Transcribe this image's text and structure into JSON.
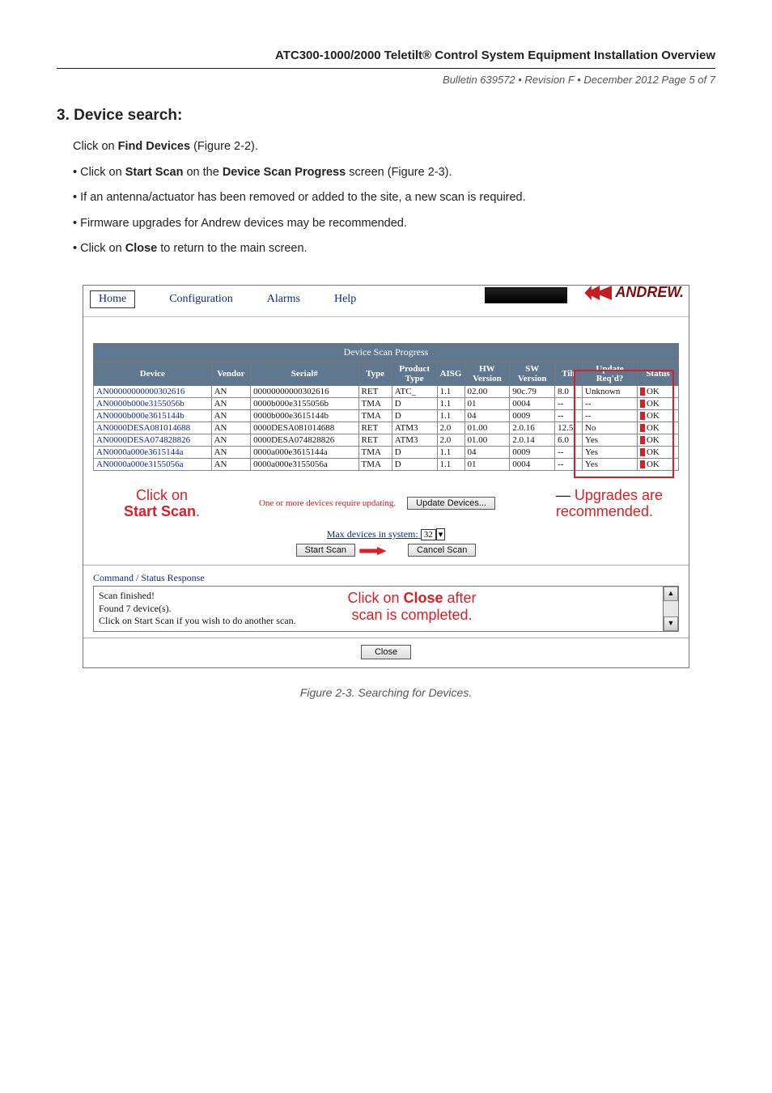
{
  "header": {
    "title": "ATC300-1000/2000 Teletilt® Control System Equipment Installation Overview",
    "meta": "Bulletin 639572 • Revision F • December 2012 Page 5 of 7"
  },
  "section": {
    "heading": "3. Device search:",
    "intro_pre": "Click on ",
    "intro_bold": "Find Devices",
    "intro_post": " (Figure 2-2).",
    "bullets": {
      "b1_pre": "• Click on ",
      "b1_bold1": "Start Scan",
      "b1_mid": " on the ",
      "b1_bold2": "Device Scan Progress",
      "b1_post": " screen (Figure 2-3).",
      "b2": "• If an antenna/actuator has been removed or added to the site, a new scan is required.",
      "b3": "• Firmware upgrades for Andrew devices may be recommended.",
      "b4_pre": "• Click on ",
      "b4_bold": "Close",
      "b4_post": " to return to the main screen."
    }
  },
  "figure": {
    "caption": "Figure 2-3. Searching for Devices.",
    "menu": {
      "home": "Home",
      "config": "Configuration",
      "alarms": "Alarms",
      "help": "Help"
    },
    "brand": "ANDREW.",
    "table_title": "Device Scan Progress",
    "columns": {
      "device": "Device",
      "vendor": "Vendor",
      "serial": "Serial#",
      "type": "Type",
      "ptype": "Product Type",
      "aisc": "AISG",
      "hw": "HW Version",
      "sw": "SW Version",
      "tilt": "Tilt",
      "upd": "Update Req'd?",
      "status": "Status"
    },
    "rows": [
      {
        "device": "AN00000000000302616",
        "vendor": "AN",
        "serial": "00000000000302616",
        "type": "RET",
        "ptype": "ATC_",
        "aisc": "1.1",
        "hw": "02.00",
        "sw": "90c.79",
        "tilt": "8.0",
        "upd": "Unknown",
        "status": "OK"
      },
      {
        "device": "AN0000b000e3155056b",
        "vendor": "AN",
        "serial": "0000b000e3155056b",
        "type": "TMA",
        "ptype": "D",
        "aisc": "1.1",
        "hw": "01",
        "sw": "0004",
        "tilt": "--",
        "upd": "--",
        "status": "OK"
      },
      {
        "device": "AN0000b000e3615144b",
        "vendor": "AN",
        "serial": "0000b000e3615144b",
        "type": "TMA",
        "ptype": "D",
        "aisc": "1.1",
        "hw": "04",
        "sw": "0009",
        "tilt": "--",
        "upd": "--",
        "status": "OK"
      },
      {
        "device": "AN0000DESA081014688",
        "vendor": "AN",
        "serial": "0000DESA081014688",
        "type": "RET",
        "ptype": "ATM3",
        "aisc": "2.0",
        "hw": "01.00",
        "sw": "2.0.16",
        "tilt": "12.5",
        "upd": "No",
        "status": "OK"
      },
      {
        "device": "AN0000DESA074828826",
        "vendor": "AN",
        "serial": "0000DESA074828826",
        "type": "RET",
        "ptype": "ATM3",
        "aisc": "2.0",
        "hw": "01.00",
        "sw": "2.0.14",
        "tilt": "6.0",
        "upd": "Yes",
        "status": "OK"
      },
      {
        "device": "AN0000a000e3615144a",
        "vendor": "AN",
        "serial": "0000a000e3615144a",
        "type": "TMA",
        "ptype": "D",
        "aisc": "1.1",
        "hw": "04",
        "sw": "0009",
        "tilt": "--",
        "upd": "Yes",
        "status": "OK"
      },
      {
        "device": "AN0000a000e3155056a",
        "vendor": "AN",
        "serial": "0000a000e3155056a",
        "type": "TMA",
        "ptype": "D",
        "aisc": "1.1",
        "hw": "01",
        "sw": "0004",
        "tilt": "--",
        "upd": "Yes",
        "status": "OK"
      }
    ],
    "update_msg": "One or more devices require updating.",
    "update_btn": "Update Devices...",
    "max_devices_label": "Max devices in system:",
    "max_devices_value": "32",
    "start_scan_btn": "Start Scan",
    "cancel_scan_btn": "Cancel Scan",
    "cmd_title": "Command / Status Response",
    "cmd_lines": {
      "l1": "Scan finished!",
      "l2": "Found 7 device(s).",
      "l3": "Click on Start Scan if you wish to do another scan."
    },
    "close_btn": "Close",
    "annot": {
      "click_start_l1": "Click on",
      "click_start_l2": "Start Scan",
      "click_start_dot": ".",
      "upgrades_l1": "Upgrades are",
      "upgrades_l2": "recommended.",
      "close_l1_pre": "Click on ",
      "close_l1_bold": "Close",
      "close_l1_post": " after",
      "close_l2": "scan is completed."
    }
  }
}
